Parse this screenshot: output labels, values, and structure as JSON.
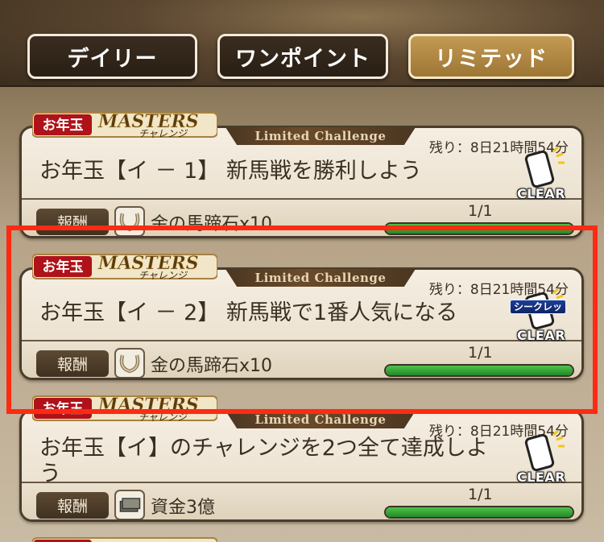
{
  "tabs": [
    {
      "label": "デイリー",
      "active": false
    },
    {
      "label": "ワンポイント",
      "active": false
    },
    {
      "label": "リミテッド",
      "active": true
    }
  ],
  "banner": {
    "otoshidama": "お年玉",
    "masters": "MASTERS",
    "challenge": "チャレンジ"
  },
  "missions": [
    {
      "strip": "Limited Challenge",
      "remaining": "残り：8日21時間54分",
      "title": "お年玉【イ － 1】 新馬戦を勝利しよう",
      "reward_label": "報酬",
      "reward_icon": "horseshoe-icon",
      "reward": "金の馬蹄石x10",
      "progress": "1/1",
      "progress_fraction": 1.0,
      "badge": "CLEAR",
      "secret": ""
    },
    {
      "strip": "Limited Challenge",
      "remaining": "残り：8日21時間54分",
      "title": "お年玉【イ － 2】 新馬戦で1番人気になる",
      "reward_label": "報酬",
      "reward_icon": "horseshoe-icon",
      "reward": "金の馬蹄石x10",
      "progress": "1/1",
      "progress_fraction": 1.0,
      "badge": "CLEAR",
      "secret": "シークレット"
    },
    {
      "strip": "Limited Challenge",
      "remaining": "残り：8日21時間54分",
      "title": "お年玉【イ】のチャレンジを2つ全て達成しよう",
      "reward_label": "報酬",
      "reward_icon": "money-stack-icon",
      "reward": "資金3億",
      "progress": "1/1",
      "progress_fraction": 1.0,
      "badge": "CLEAR",
      "secret": ""
    }
  ],
  "colors": {
    "accent": "#b48a45",
    "highlight": "#ff2a12",
    "progress": "#2fa533"
  }
}
